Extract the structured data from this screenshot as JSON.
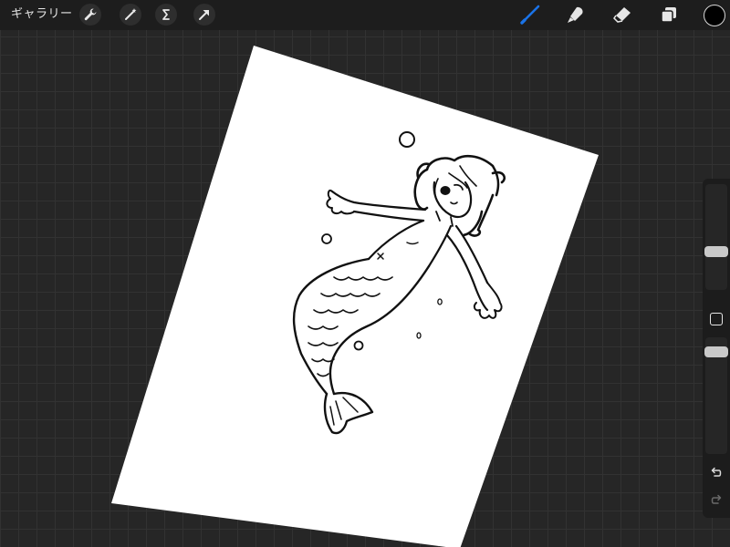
{
  "toolbar": {
    "gallery_label": "ギャラリー",
    "left_tools": [
      "wrench-icon",
      "magic-wand-icon",
      "selection-s-icon",
      "transform-arrow-icon"
    ],
    "right_tools": [
      "brush-icon",
      "smudge-icon",
      "eraser-icon",
      "layers-icon"
    ],
    "active_tool": "brush",
    "active_color": "#1a73e8",
    "current_color": "#000000"
  },
  "sidebar": {
    "brush_size_level": 0.2,
    "opacity_level": 0.85,
    "actions": [
      "undo-icon",
      "redo-icon"
    ]
  },
  "canvas": {
    "paper_color": "#ffffff",
    "drawing": "mermaid-line-art"
  }
}
